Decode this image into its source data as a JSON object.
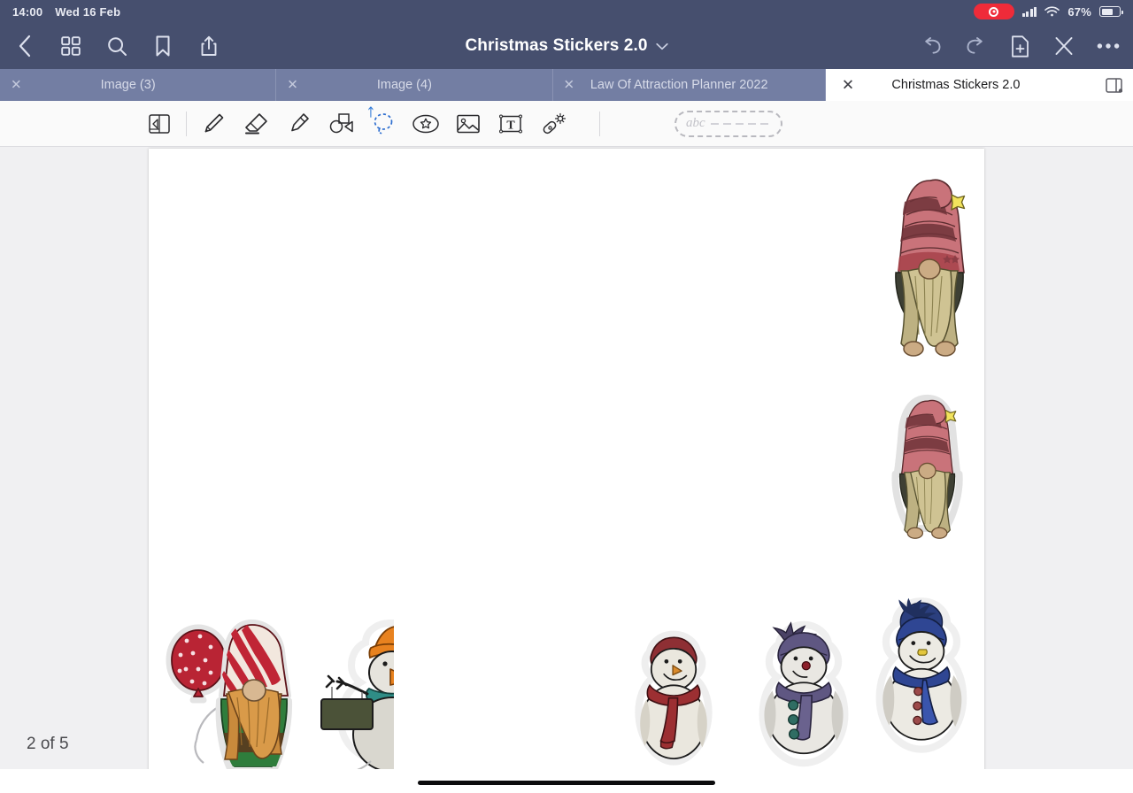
{
  "status_bar": {
    "time": "14:00",
    "date": "Wed 16 Feb",
    "battery_percent": "67%",
    "battery_level": 67,
    "recording_icon": "record-icon",
    "cellular_icon": "cellular-signal-icon",
    "wifi_icon": "wifi-icon",
    "battery_icon": "battery-icon"
  },
  "header": {
    "back_icon": "back-chevron-icon",
    "thumbnails_icon": "grid-thumbnails-icon",
    "search_icon": "search-icon",
    "bookmark_icon": "bookmark-icon",
    "share_icon": "share-icon",
    "title": "Christmas Stickers 2.0",
    "title_chevron_icon": "chevron-down-icon",
    "undo_icon": "undo-icon",
    "redo_icon": "redo-icon",
    "add_page_icon": "add-page-icon",
    "close_icon": "close-x-icon",
    "more_icon": "more-ellipsis-icon"
  },
  "tabs": {
    "items": [
      {
        "label": "Image (3)",
        "active": false,
        "close_icon": "close-tab-icon"
      },
      {
        "label": "Image (4)",
        "active": false,
        "close_icon": "close-tab-icon"
      },
      {
        "label": "Law Of Attraction Planner 2022",
        "active": false,
        "close_icon": "close-tab-icon"
      },
      {
        "label": "Christmas Stickers 2.0",
        "active": true,
        "close_icon": "close-tab-icon"
      }
    ],
    "split_view_icon": "split-view-icon"
  },
  "toolbar": {
    "tools": [
      {
        "name": "page-flip-tool",
        "selected": false
      },
      {
        "name": "pen-tool",
        "selected": false
      },
      {
        "name": "eraser-tool",
        "selected": false
      },
      {
        "name": "highlighter-tool",
        "selected": false
      },
      {
        "name": "shapes-tool",
        "selected": false
      },
      {
        "name": "lasso-select-tool",
        "selected": true,
        "badge": "bluetooth-icon"
      },
      {
        "name": "sticker-tool",
        "selected": false
      },
      {
        "name": "image-tool",
        "selected": false
      },
      {
        "name": "text-tool",
        "selected": false
      },
      {
        "name": "magic-wand-tool",
        "selected": false
      }
    ],
    "selection_chip_label": "abc"
  },
  "canvas": {
    "page_indicator": "2 of 5",
    "stickers": [
      {
        "name": "gnome-striped-hat-star-large",
        "description": "Gnome with striped maroon hat and yellow star"
      },
      {
        "name": "gnome-striped-hat-star-small",
        "description": "Smaller gnome with striped hat and yellow star"
      },
      {
        "name": "gnome-with-red-balloon",
        "description": "Gnome with candy-striped hat holding red polka dot balloon"
      },
      {
        "name": "snowman-with-sign",
        "description": "Snowman with orange hat holding hanging sign"
      },
      {
        "name": "snowman-red-scarf",
        "description": "Snowman with dark red hat and scarf"
      },
      {
        "name": "snowman-purple-scarf",
        "description": "Snowman with purple pom hat and teal buttons"
      },
      {
        "name": "snowman-blue-scarf",
        "description": "Snowman with navy pom hat and red buttons"
      }
    ]
  },
  "colors": {
    "chrome": "#464f6e",
    "tab_inactive": "#737ea3",
    "accent": "#2f6fd0",
    "record": "#ef2b39",
    "canvas_bg": "#f0f0f2"
  }
}
